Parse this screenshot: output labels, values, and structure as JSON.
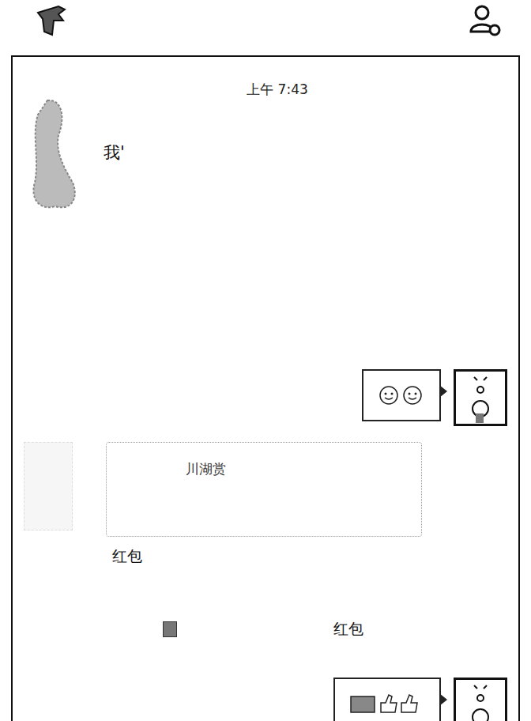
{
  "time": "上午 7:43",
  "messages": [
    {
      "side": "left",
      "kind": "text",
      "text": "我'"
    },
    {
      "side": "right",
      "kind": "sticker",
      "text": ""
    },
    {
      "side": "left",
      "kind": "red-packet",
      "title": "川湖赏",
      "label": "红包"
    },
    {
      "side": "center",
      "kind": "system",
      "text": "红包"
    },
    {
      "side": "right",
      "kind": "thumbs",
      "text": ""
    }
  ]
}
